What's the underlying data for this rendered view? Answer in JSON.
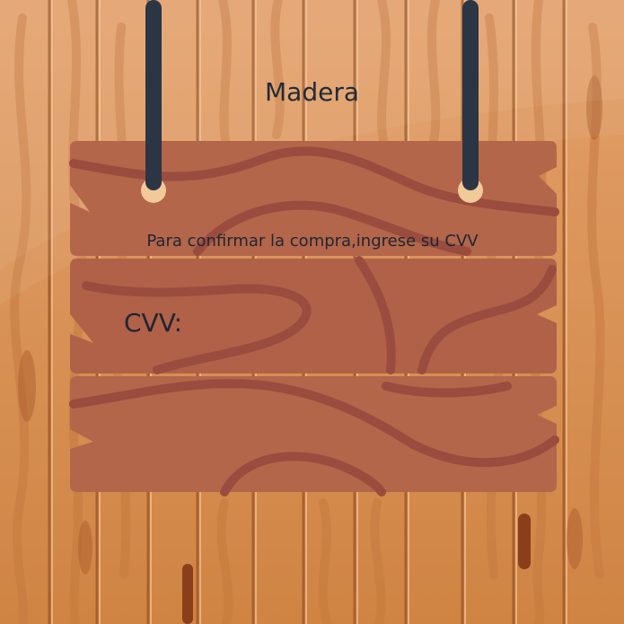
{
  "page": {
    "title": "Madera",
    "prompt": "Para confirmar la compra,ingrese su CVV",
    "cvv_label": "CVV:",
    "cvv_value": ""
  },
  "colors": {
    "background_light": "#e3a06a",
    "background_dark": "#c97c42",
    "plank": "#b3664a",
    "plank_grain": "#9a4d3e",
    "rope": "#2c3544",
    "text": "#1f2533"
  },
  "icons": {
    "sign": "wooden-sign-icon",
    "rope": "rope-icon"
  }
}
